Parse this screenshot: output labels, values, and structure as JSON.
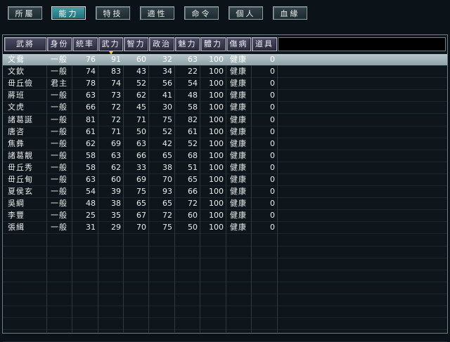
{
  "tabs": [
    {
      "label": "所屬",
      "active": false
    },
    {
      "label": "能力",
      "active": true
    },
    {
      "label": "特技",
      "active": false
    },
    {
      "label": "適性",
      "active": false
    },
    {
      "label": "命令",
      "active": false
    },
    {
      "label": "個人",
      "active": false
    },
    {
      "label": "血緣",
      "active": false
    }
  ],
  "columns": [
    "武將",
    "身份",
    "統率",
    "武力",
    "智力",
    "政治",
    "魅力",
    "體力",
    "傷病",
    "道具"
  ],
  "sorted_column": "武力",
  "rows": [
    {
      "name": "文鴦",
      "rank": "一般",
      "lead": "76",
      "war": "91",
      "int": "60",
      "pol": "32",
      "chr": "63",
      "hp": "100",
      "status": "健康",
      "items": "0",
      "selected": true
    },
    {
      "name": "文欽",
      "rank": "一般",
      "lead": "74",
      "war": "83",
      "int": "43",
      "pol": "34",
      "chr": "22",
      "hp": "100",
      "status": "健康",
      "items": "0"
    },
    {
      "name": "毌丘儉",
      "rank": "君主",
      "lead": "78",
      "war": "74",
      "int": "52",
      "pol": "56",
      "chr": "54",
      "hp": "100",
      "status": "健康",
      "items": "0"
    },
    {
      "name": "蔣班",
      "rank": "一般",
      "lead": "63",
      "war": "73",
      "int": "62",
      "pol": "41",
      "chr": "48",
      "hp": "100",
      "status": "健康",
      "items": "0"
    },
    {
      "name": "文虎",
      "rank": "一般",
      "lead": "66",
      "war": "72",
      "int": "45",
      "pol": "30",
      "chr": "58",
      "hp": "100",
      "status": "健康",
      "items": "0"
    },
    {
      "name": "諸葛誕",
      "rank": "一般",
      "lead": "81",
      "war": "72",
      "int": "71",
      "pol": "75",
      "chr": "82",
      "hp": "100",
      "status": "健康",
      "items": "0"
    },
    {
      "name": "唐咨",
      "rank": "一般",
      "lead": "61",
      "war": "71",
      "int": "50",
      "pol": "52",
      "chr": "61",
      "hp": "100",
      "status": "健康",
      "items": "0"
    },
    {
      "name": "焦彝",
      "rank": "一般",
      "lead": "62",
      "war": "69",
      "int": "63",
      "pol": "42",
      "chr": "52",
      "hp": "100",
      "status": "健康",
      "items": "0"
    },
    {
      "name": "諸葛靚",
      "rank": "一般",
      "lead": "58",
      "war": "63",
      "int": "66",
      "pol": "65",
      "chr": "68",
      "hp": "100",
      "status": "健康",
      "items": "0"
    },
    {
      "name": "毌丘秀",
      "rank": "一般",
      "lead": "58",
      "war": "62",
      "int": "33",
      "pol": "38",
      "chr": "51",
      "hp": "100",
      "status": "健康",
      "items": "0"
    },
    {
      "name": "毌丘甸",
      "rank": "一般",
      "lead": "63",
      "war": "60",
      "int": "69",
      "pol": "70",
      "chr": "65",
      "hp": "100",
      "status": "健康",
      "items": "0"
    },
    {
      "name": "夏侯玄",
      "rank": "一般",
      "lead": "54",
      "war": "39",
      "int": "75",
      "pol": "93",
      "chr": "66",
      "hp": "100",
      "status": "健康",
      "items": "0"
    },
    {
      "name": "吳綱",
      "rank": "一般",
      "lead": "48",
      "war": "38",
      "int": "65",
      "pol": "65",
      "chr": "72",
      "hp": "100",
      "status": "健康",
      "items": "0"
    },
    {
      "name": "李豐",
      "rank": "一般",
      "lead": "25",
      "war": "35",
      "int": "67",
      "pol": "72",
      "chr": "60",
      "hp": "100",
      "status": "健康",
      "items": "0"
    },
    {
      "name": "張緝",
      "rank": "一般",
      "lead": "31",
      "war": "29",
      "int": "70",
      "pol": "75",
      "chr": "50",
      "hp": "100",
      "status": "健康",
      "items": "0"
    }
  ]
}
